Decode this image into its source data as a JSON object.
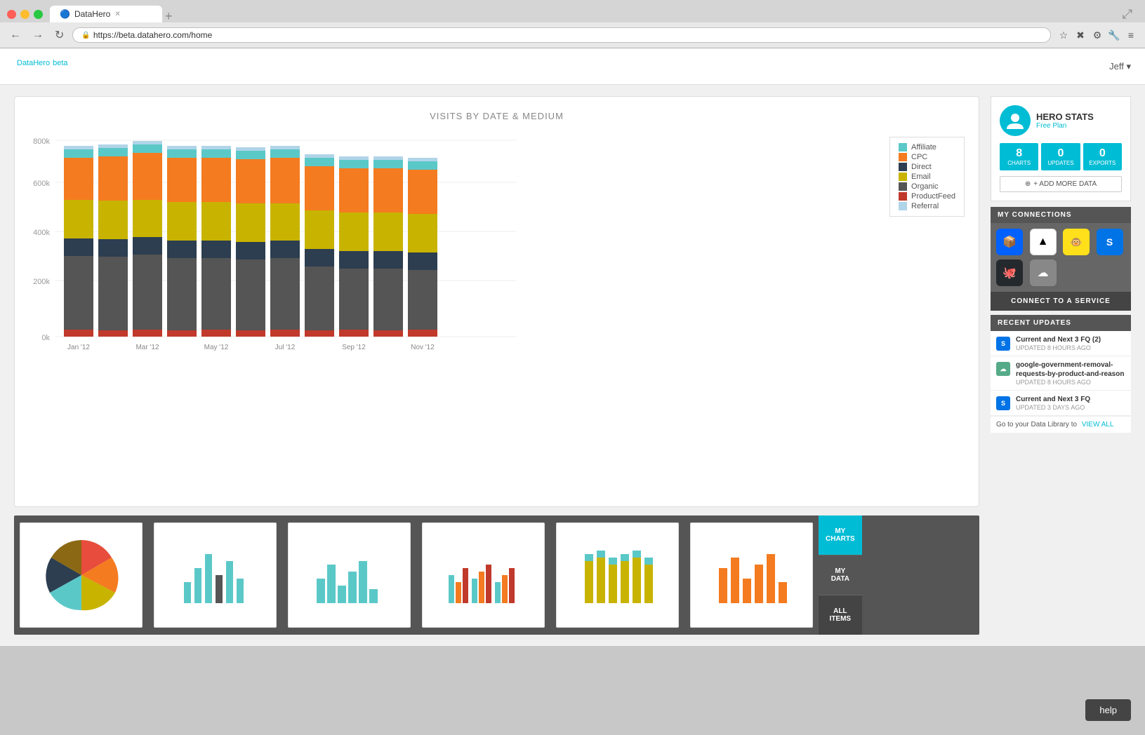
{
  "browser": {
    "url": "https://beta.datahero.com/home",
    "tab_title": "DataHero",
    "back_btn": "←",
    "forward_btn": "→",
    "refresh_btn": "↻"
  },
  "app": {
    "logo": "DataHero",
    "logo_badge": "beta",
    "user": "Jeff ▾"
  },
  "chart": {
    "title": "VISITS BY DATE & MEDIUM",
    "y_labels": [
      "800k",
      "600k",
      "400k",
      "200k",
      "0k"
    ],
    "x_labels": [
      "Jan '12",
      "Mar '12",
      "May '12",
      "Jul '12",
      "Sep '12",
      "Nov '12"
    ],
    "legend": [
      {
        "label": "Affiliate",
        "color": "#5bc8c8"
      },
      {
        "label": "CPC",
        "color": "#f47b20"
      },
      {
        "label": "Direct",
        "color": "#2c3e50"
      },
      {
        "label": "Email",
        "color": "#c8b400"
      },
      {
        "label": "Organic",
        "color": "#8b8b00"
      },
      {
        "label": "ProductFeed",
        "color": "#c0392b"
      },
      {
        "label": "Referral",
        "color": "#b0d4e8"
      }
    ]
  },
  "hero_stats": {
    "name": "HERO STATS",
    "plan": "Free Plan",
    "charts_count": "8",
    "charts_label": "CHARTS",
    "updates_count": "0",
    "updates_label": "UPDATES",
    "exports_count": "0",
    "exports_label": "EXPORTS",
    "add_data": "+ ADD MORE DATA"
  },
  "connections": {
    "header": "MY CONNECTIONS",
    "connect_btn": "CONNECT TO A SERVICE"
  },
  "recent_updates": {
    "header": "RECENT UPDATES",
    "items": [
      {
        "title": "Current and Next 3 FQ (2)",
        "time": "UPDATED 8 HOURS AGO",
        "type": "smartsheet"
      },
      {
        "title": "google-government-removal-requests-by-product-and-reason",
        "time": "UPDATED 8 HOURS AGO",
        "type": "cloud"
      },
      {
        "title": "Current and Next 3 FQ",
        "time": "UPDATED 3 DAYS AGO",
        "type": "smartsheet"
      }
    ],
    "view_all_prefix": "Go to your Data Library to",
    "view_all_link": "VIEW ALL"
  },
  "sidebar_nav": {
    "my_charts": "MY\nCHARTS",
    "my_data": "MY\nDATA",
    "all_items": "ALL\nITEMS"
  },
  "help": "help"
}
